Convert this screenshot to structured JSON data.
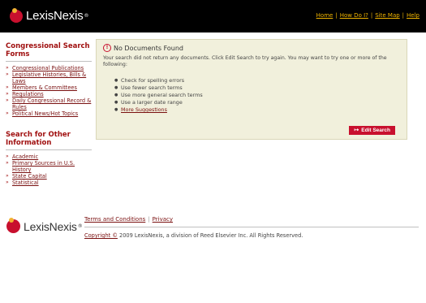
{
  "header": {
    "logo_text": "LexisNexis",
    "logo_reg": "®",
    "nav": [
      "Home",
      "How Do I?",
      "Site Map",
      "Help"
    ]
  },
  "sidebar": {
    "section1_title": "Congressional Search Forms",
    "section1_items": [
      "Congressional Publications",
      "Legislative Histories, Bills & Laws",
      "Members & Committees",
      "Regulations",
      "Daily Congressional Record & Rules",
      "Political News/Hot Topics"
    ],
    "section2_title": "Search for Other Information",
    "section2_items": [
      "Academic",
      "Primary Sources in U.S. History",
      "State Capital",
      "Statistical"
    ]
  },
  "message": {
    "title": "No Documents Found",
    "text": "Your search did not return any documents. Click Edit Search to try again. You may want to try one or more of the following:",
    "tips": [
      "Check for spelling errors",
      "Use fewer search terms",
      "Use more general search terms",
      "Use a larger date range"
    ],
    "more_link": "More Suggestions",
    "edit_button": "Edit Search"
  },
  "footer": {
    "logo_text": "LexisNexis",
    "logo_reg": "®",
    "terms_link": "Terms and Conditions",
    "privacy_link": "Privacy",
    "copyright_link": "Copyright ©",
    "copyright_text": " 2009 LexisNexis, a division of Reed Elsevier Inc. All Rights Reserved."
  },
  "colors": {
    "accent": "#c8102e",
    "link": "#7a1010",
    "header_bg": "#000000",
    "nav_link": "#f0b400",
    "message_bg": "#f1f0dc"
  }
}
